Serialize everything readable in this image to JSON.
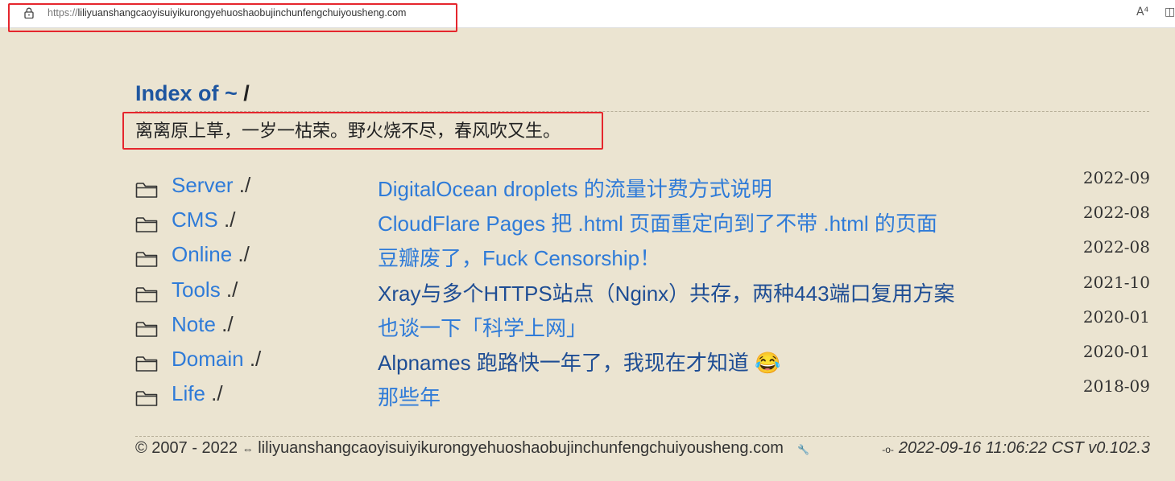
{
  "browser": {
    "url_protocol": "https://",
    "url_host": "liliyuanshangcaoyisuiyikurongyehuoshaobujinchunfengchuiyousheng.com",
    "read_aloud_icon": "A⁴",
    "split_icon": "◫"
  },
  "page": {
    "title_prefix": "Index of ~",
    "title_slash": " /",
    "motto": "离离原上草，一岁一枯荣。野火烧不尽，春风吹又生。"
  },
  "rows": [
    {
      "category": "Server",
      "post": "DigitalOcean droplets 的流量计费方式说明",
      "date": "2022-09",
      "visited": false
    },
    {
      "category": "CMS",
      "post": "CloudFlare Pages 把 .html 页面重定向到了不带 .html 的页面",
      "date": "2022-08",
      "visited": false
    },
    {
      "category": "Online",
      "post": "豆瓣废了，Fuck Censorship！",
      "date": "2022-08",
      "visited": false
    },
    {
      "category": "Tools",
      "post": "Xray与多个HTTPS站点（Nginx）共存，两种443端口复用方案",
      "date": "2021-10",
      "visited": true
    },
    {
      "category": "Note",
      "post": "也谈一下「科学上网」",
      "date": "2020-01",
      "visited": false
    },
    {
      "category": "Domain",
      "post": "Alpnames 跑路快一年了，我现在才知道 😂",
      "date": "2020-01",
      "visited": true
    },
    {
      "category": "Life",
      "post": "那些年",
      "date": "2018-09",
      "visited": false
    }
  ],
  "dir_suffix": " ./",
  "footer": {
    "copyright": "© 2007 - 2022",
    "link_icon": "⇔",
    "domain": "liliyuanshangcaoyisuiyikurongyehuoshaobujinchunfengchuiyousheng.com",
    "tool_icon": "🔧",
    "commit_icon": "-o-",
    "timestamp": "2022-09-16 11:06:22 CST v0.102.3"
  }
}
